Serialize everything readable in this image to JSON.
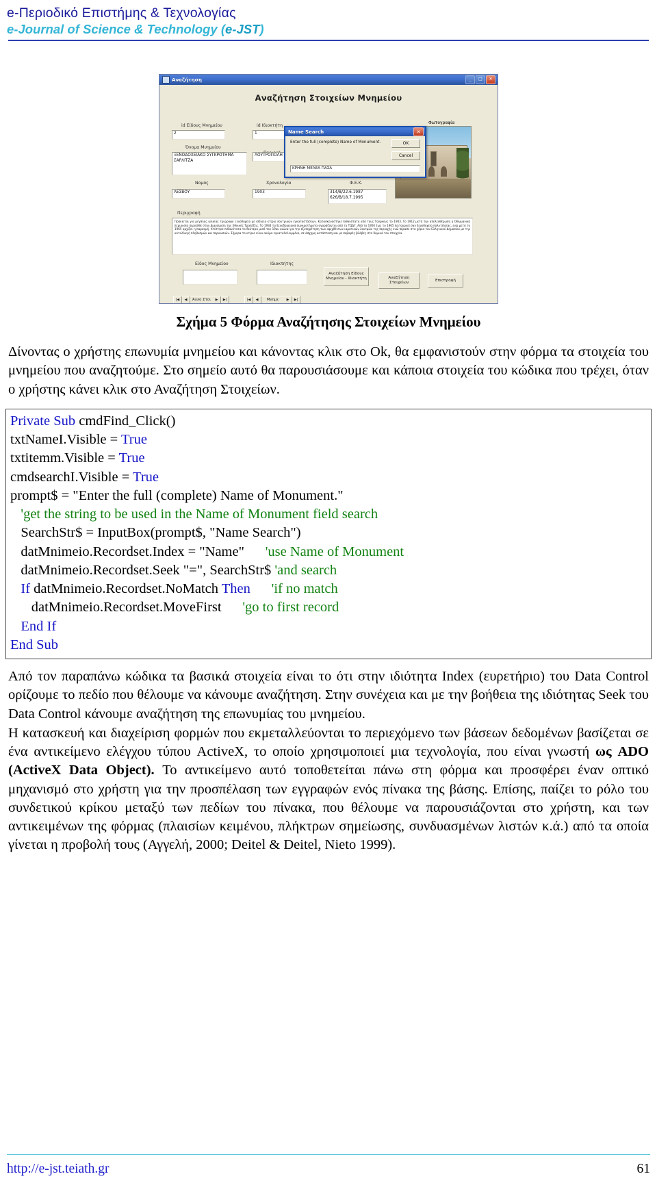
{
  "masthead": {
    "greek": "e-Περιοδικό Επιστήμης & Τεχνολογίας",
    "english_prefix": "e-Journal of Science & Technology (",
    "english_abbr": "e-JST",
    "english_suffix": ")"
  },
  "figure": {
    "window": {
      "title": "Αναζήτηση",
      "minimize": "_",
      "maximize": "□",
      "close": "✕"
    },
    "heading": "Αναζήτηση Στοιχείων Μνημείου",
    "labels": {
      "id_eidous": "id Είδους Μνημείου",
      "id_idioktiti": "id Ιδιοκτήτη",
      "onoma": "Όνομα Μνημείου",
      "perioxi": "Περιοχή",
      "nomos": "Νομός",
      "xronologia": "Χρονολογία",
      "fek": "Φ.Ε.Κ.",
      "perigrafi": "Περιγραφή",
      "fotografia": "Φωτογραφία",
      "eidos_mnimeiou": "Είδος Μνημείου",
      "idioktitis": "Ιδιοκτήτης"
    },
    "values": {
      "id_eidous": "2",
      "id_idioktiti": "1",
      "onoma": "ΞΕΝΟΔΟΧΕΙΑΚΟ ΣΥΓΚΡΟΤΗΜΑ ΣΑΡΛΙΤΖΑ",
      "perioxi": "ΛΟΥΤΡΟΠΟΛΗ ΘΕΡΜΗΣ",
      "nomos": "ΛΕΣΒΟΥ",
      "xronologia": "1903",
      "fek": "314/B/22.6.1987\n626/B/18.7.1995",
      "perigrafi": "Πρόκειται για μεγάλης ηλικίας τριώροφο Ξενοδοχείο με ισόγειο κτίριο λουτρικών εγκαταστάσεων. Κατασκευάστηκε πιθανότατα από τους Τούρκους το 1903. Το 1912 μετά την απελευθέρωση η Οθωμανική περιουσία περιήλθε στην Διαχείριση της Εθνικής Τραπέζης. Το 1934 τα ξενοδοχειακά συγκροτήματα αγοράζονται από το ΤΩΔΥ. Από το 1950 έως το 1965 λειτουργεί σαν ξενοδοχείο πολυτελείας, ενώ μετά το 1965 αρχίζει η παρακμή. Χτίστηκε πιθανότατα το δεύτερο μισό του 19ου αιώνα για την εξυπηρέτηση των αφιχθέντων ιαματικών λουτρών της περιοχής ενώ πέρασε στα χέρια του Ελληνικού Δημοσίου με την ανταλλαγή πληθυσμών και περιουσιών. Σήμερα το κτίριο είναι ακόμα εγκαταλελειμμένο, σε άσχημη κατάσταση και με σοβαρές βλάβες στα δομικά του στοιχεία.",
      "eidos_mnimeiou": "",
      "idioktitis": ""
    },
    "buttons": {
      "anazitisi_eidous": "Αναζήτηση Είδους Μνημείου - Ιδιοκτήτη",
      "anazitisi_stoixeion": "Αναζήτηση Στοιχείων",
      "epistrofi": "Επιστροφή"
    },
    "navigators": {
      "left_label": "Άλλο Στοι",
      "right_label": "Μνημε",
      "first": "|◀",
      "prev": "◀",
      "next": "▶",
      "last": "▶|"
    },
    "dialog": {
      "title": "Name Search",
      "close": "✕",
      "prompt": "Enter the full (complete) Name of Monument.",
      "ok": "OK",
      "cancel": "Cancel",
      "input_value": "ΚΡΗΝΗ ΜΕΛΕΑ ΠΑΣΑ"
    }
  },
  "caption": "Σχήμα 5  Φόρμα Αναζήτησης Στοιχείων Μνημείου",
  "paragraphs": {
    "p1": "Δίνοντας ο χρήστης επωνυμία μνημείου και κάνοντας κλικ στο Ok, θα εμφανιστούν στην φόρμα τα στοιχεία του μνημείου που αναζητούμε. Στο σημείο αυτό θα παρουσιάσουμε και κάποια στοιχεία του κώδικα που τρέχει, όταν ο χρήστης κάνει κλικ στο Αναζήτηση Στοιχείων.",
    "p2_a": "Από τον παραπάνω κώδικα τα βασικά στοιχεία είναι το ότι στην ιδιότητα Index (ευρετήριο)   του Data Control ορίζουμε το πεδίο που θέλουμε να κάνουμε αναζήτηση. Στην συνέχεια και με την βοήθεια της ιδιότητας Seek του Data Control κάνουμε αναζήτηση της επωνυμίας του μνημείου.",
    "p3_a": "Η κατασκευή και διαχείριση φορμών που εκμεταλλεύονται το περιεχόμενο των βάσεων δεδομένων βασίζεται σε ένα αντικείμενο ελέγχου τύπου ActiveX, το οποίο χρησιμοποιεί μια τεχνολογία, που είναι γνωστή ",
    "p3_bold": "ως ADO (ActiveX Data Object).",
    "p3_b": " Το αντικείμενο αυτό τοποθετείται πάνω στη φόρμα και προσφέρει έναν οπτικό μηχανισμό στο χρήστη για την προσπέλαση των εγγραφών ενός πίνακα της βάσης. Επίσης, παίζει το ρόλο του συνδετικού κρίκου μεταξύ των πεδίων του πίνακα, που θέλουμε να παρουσιάζονται στο χρήστη, και των αντικειμένων της φόρμας (πλαισίων κειμένου, πλήκτρων σημείωσης, συνδυασμένων λιστών κ.ά.) από τα οποία γίνεται η προβολή τους (Αγγελή, 2000; Deitel & Deitel, Nieto 1999)."
  },
  "code": {
    "lines": [
      [
        {
          "t": "Private Sub",
          "c": "kw"
        },
        {
          "t": " cmdFind_Click()",
          "c": ""
        }
      ],
      [
        {
          "t": "txtNameI.Visible = ",
          "c": ""
        },
        {
          "t": "True",
          "c": "kw"
        }
      ],
      [
        {
          "t": "txtitemm.Visible = ",
          "c": ""
        },
        {
          "t": "True",
          "c": "kw"
        }
      ],
      [
        {
          "t": "cmdsearchI.Visible = ",
          "c": ""
        },
        {
          "t": "True",
          "c": "kw"
        }
      ],
      [
        {
          "t": "prompt$ = \"Enter the full (complete) Name of Monument.\"",
          "c": ""
        }
      ],
      [
        {
          "t": "   'get the string to be used in the Name of Monument field search",
          "c": "cmt"
        }
      ],
      [
        {
          "t": "   SearchStr$ = InputBox(prompt$, \"Name Search\")",
          "c": ""
        }
      ],
      [
        {
          "t": "   datMnimeio.Recordset.Index = \"Name\"      ",
          "c": ""
        },
        {
          "t": "'use Name of Monument",
          "c": "cmt"
        }
      ],
      [
        {
          "t": "   datMnimeio.Recordset.Seek \"=\", SearchStr$ ",
          "c": ""
        },
        {
          "t": "'and search",
          "c": "cmt"
        }
      ],
      [
        {
          "t": "   ",
          "c": ""
        },
        {
          "t": "If",
          "c": "kw"
        },
        {
          "t": " datMnimeio.Recordset.NoMatch ",
          "c": ""
        },
        {
          "t": "Then",
          "c": "kw"
        },
        {
          "t": "      ",
          "c": ""
        },
        {
          "t": "'if no match",
          "c": "cmt"
        }
      ],
      [
        {
          "t": "      datMnimeio.Recordset.MoveFirst      ",
          "c": ""
        },
        {
          "t": "'go to first record",
          "c": "cmt"
        }
      ],
      [
        {
          "t": "   ",
          "c": ""
        },
        {
          "t": "End If",
          "c": "kw"
        }
      ],
      [
        {
          "t": "End Sub",
          "c": "kw"
        }
      ]
    ]
  },
  "footer": {
    "url": "http://e-jst.teiath.gr",
    "page": "61"
  }
}
